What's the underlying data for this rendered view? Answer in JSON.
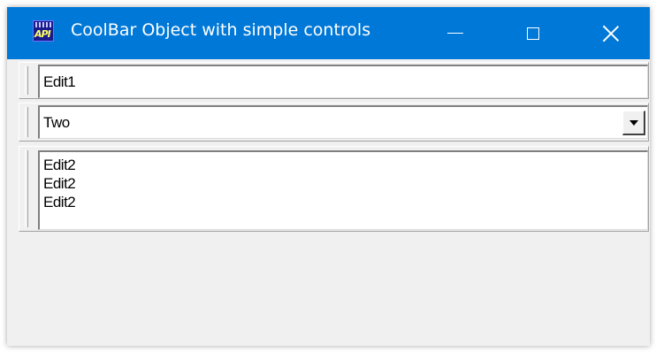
{
  "window": {
    "title": "CoolBar Object with simple controls",
    "icon_text": "API"
  },
  "titlebar_controls": {
    "minimize": "minimize-icon",
    "maximize": "maximize-icon",
    "close": "close-icon"
  },
  "coolbar": {
    "edit1_value": "Edit1",
    "combo_value": "Two",
    "edit2_lines": [
      "Edit2",
      "Edit2",
      "Edit2"
    ]
  },
  "colors": {
    "titlebar": "#0078d7",
    "client": "#f0f0f0"
  }
}
